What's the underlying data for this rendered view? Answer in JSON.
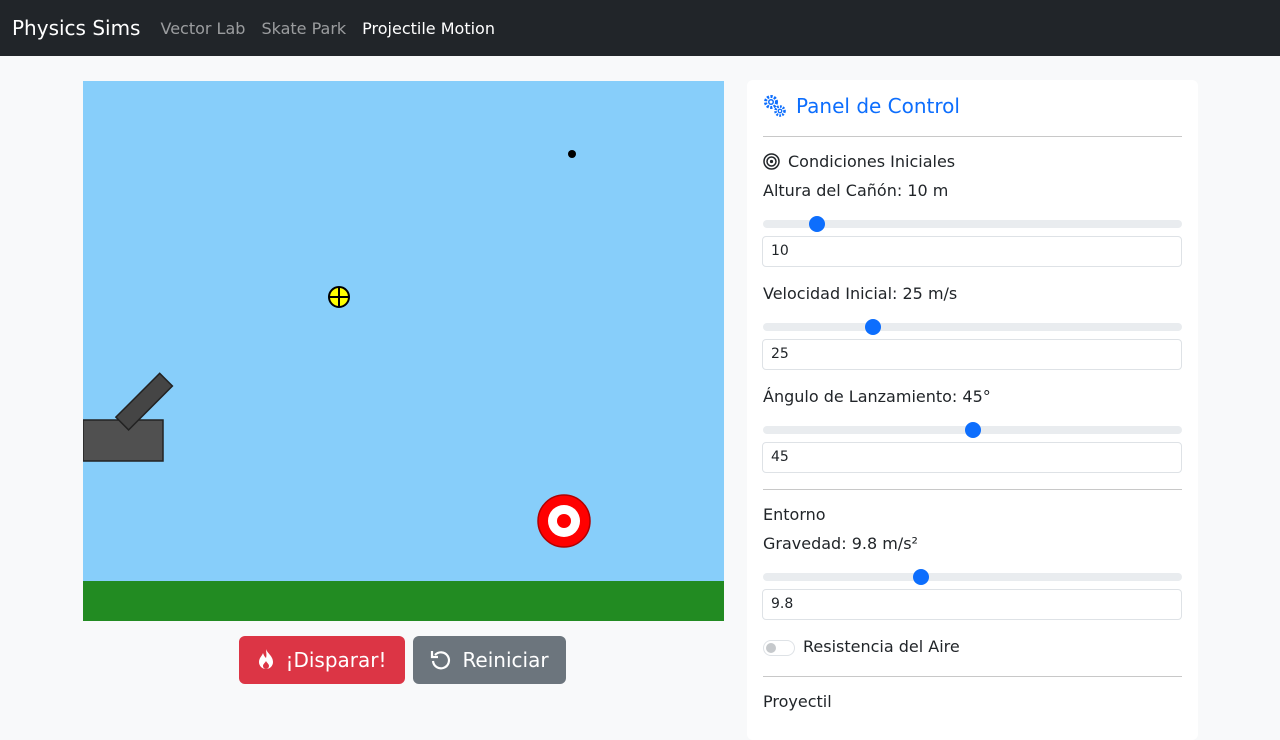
{
  "navbar": {
    "brand": "Physics Sims",
    "links": [
      {
        "label": "Vector Lab",
        "active": false
      },
      {
        "label": "Skate Park",
        "active": false
      },
      {
        "label": "Projectile Motion",
        "active": true
      }
    ]
  },
  "simulation": {
    "sky_color": "#87cefa",
    "ground_color": "#228b22",
    "cannon_color": "#505050",
    "target_color": "#ff0000",
    "ball_color": "#000000",
    "marker_color": "#ffff00"
  },
  "buttons": {
    "fire": {
      "label": "¡Disparar!",
      "icon": "fire-icon",
      "color": "#dc3545"
    },
    "reset": {
      "label": "Reiniciar",
      "icon": "reset-icon",
      "color": "#6c757d"
    }
  },
  "panel": {
    "title": "Panel de Control",
    "title_icon": "gears-icon",
    "accent": "#0d6efd",
    "initial": {
      "title": "Condiciones Iniciales",
      "icon": "target-icon",
      "height": {
        "label": "Altura del Cañón: 10 m",
        "value": "10",
        "fraction": 0.115
      },
      "velocity": {
        "label": "Velocidad Inicial: 25 m/s",
        "value": "25",
        "fraction": 0.253
      },
      "angle": {
        "label": "Ángulo de Lanzamiento: 45°",
        "value": "45",
        "fraction": 0.5
      }
    },
    "environment": {
      "title": "Entorno",
      "gravity": {
        "label": "Gravedad: 9.8 m/s²",
        "value": "9.8",
        "fraction": 0.372
      },
      "air_resistance": {
        "label": "Resistencia del Aire",
        "checked": false
      }
    },
    "projectile": {
      "title": "Proyectil"
    }
  }
}
